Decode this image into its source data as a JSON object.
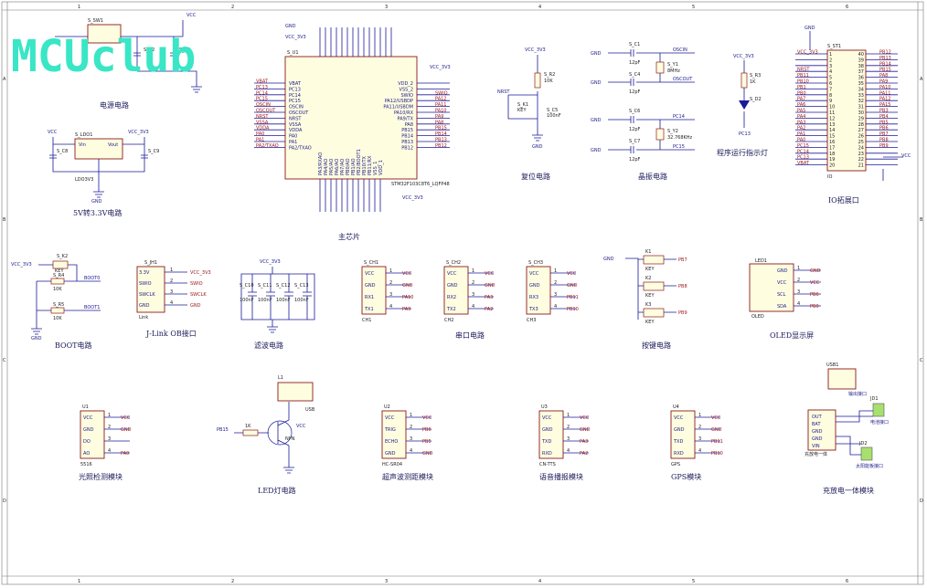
{
  "logo": "MCUclub",
  "sections": {
    "power": "电源电路",
    "ldo": "5V转3.3V电路",
    "main": "主芯片",
    "reset": "复位电路",
    "crystal": "晶振电路",
    "led_run": "程序运行指示灯",
    "io": "IO拓展口",
    "boot": "BOOT电路",
    "jlink": "J-Link OB接口",
    "filter": "滤波电路",
    "serial": "串口电路",
    "key": "按键电路",
    "oled": "OLED显示屏",
    "light": "光照检测模块",
    "ledlamp": "LED灯电路",
    "ultra": "超声波测距模块",
    "voice": "语音播报模块",
    "gps": "GPS模块",
    "charge": "充放电一体模块"
  },
  "mcu": {
    "ref": "S_U1",
    "part": "STM32F103C8T6_LQFP48",
    "left_pins": [
      "VBAT",
      "PC13",
      "PC14",
      "PC15",
      "OSCIN",
      "OSCOUT",
      "NRST",
      "VSSA",
      "VDDA",
      "PA0",
      "PA1",
      "PA2/TXAO"
    ],
    "right_pins": [
      "VDD_2",
      "VSS_2",
      "SWIO",
      "PA12/USBDP",
      "PA11/USBDM",
      "PA10/RX",
      "PA9/TX",
      "PA8",
      "PB15",
      "PB14",
      "PB13",
      "PB12"
    ],
    "right_nets": [
      "",
      "",
      "SWIO",
      "PA12",
      "PA11",
      "PA10",
      "PA9",
      "PA8",
      "PB15",
      "PB14",
      "PB13",
      "PB12"
    ],
    "bottom_pins": [
      "PA3/RXAO",
      "PA4/AO",
      "PA5/AO",
      "PA6/AO",
      "PA7/AO",
      "PB0/AO",
      "PB1/AO",
      "PB2/BOOT1",
      "PB10/TX",
      "PB11/RX",
      "VSS_1",
      "VDD_1"
    ],
    "net_vcc": "VCC_3V3",
    "gnd": "GND"
  },
  "power": {
    "switch": "S_SW1",
    "cap1": "S_C2",
    "cap2": "S_C3",
    "vcc": "VCC"
  },
  "ldo": {
    "ref": "S_LDO1",
    "part": "LDO3V3",
    "vin": "Vin",
    "vout": "Vout",
    "c_in": "S_C8",
    "c_out": "S_C9",
    "vcc_in": "VCC",
    "vcc_out": "VCC_3V3",
    "gnd": "GND"
  },
  "reset": {
    "net": "NRST",
    "res": "S_R2",
    "res_val": "10K",
    "key": "S_K1",
    "key_val": "KEY",
    "cap": "S_C5",
    "cap_val": "100nF",
    "vcc": "VCC_3V3",
    "gnd": "GND"
  },
  "crystal": {
    "c1": "S_C1",
    "c2": "S_C4",
    "c3": "S_C6",
    "c4": "S_C7",
    "cap_val": "12pF",
    "y1": "S_Y1",
    "y1_val": "8MHz",
    "y2": "S_Y2",
    "y2_val": "32.768KHz",
    "nets": [
      "OSCIN",
      "OSCOUT",
      "PC14",
      "PC15"
    ],
    "gnd": "GND"
  },
  "led_run": {
    "vcc": "VCC_3V3",
    "res": "S_R3",
    "res_val": "1K",
    "led": "S_D2",
    "net": "PC13"
  },
  "io": {
    "ref": "S_ST1",
    "part": "IO",
    "left": [
      "VCC_3V3",
      "",
      "",
      "NRST",
      "PB11",
      "PB10",
      "PB1",
      "PB0",
      "PA7",
      "PA6",
      "PA5",
      "PA4",
      "PA3",
      "PA2",
      "PA1",
      "PA0",
      "PC15",
      "PC14",
      "PC13",
      "VBAT"
    ],
    "right": [
      "PB12",
      "PB13",
      "PB14",
      "PB15",
      "PA8",
      "PA9",
      "PA10",
      "PA11",
      "PA12",
      "PA15",
      "PB3",
      "PB4",
      "PB5",
      "PB6",
      "PB7",
      "PB8",
      "PB9",
      "",
      "",
      ""
    ],
    "vcc": "VCC",
    "gnd": "GND"
  },
  "boot": {
    "key": "S_K2",
    "key_val": "KEY",
    "r4": "S_R4",
    "r5": "S_R5",
    "res_val": "10K",
    "net0": "BOOT0",
    "net1": "BOOT1",
    "vcc": "VCC_3V3",
    "gnd": "GND"
  },
  "jlink": {
    "ref": "S_JH1",
    "pins": [
      "3.3V",
      "SWIO",
      "SWCLK",
      "GND"
    ],
    "nets": [
      "VCC_3V3",
      "SWIO",
      "SWCLK",
      "GND"
    ],
    "label": "Link"
  },
  "filter": {
    "caps": [
      "S_C10",
      "S_C11",
      "S_C12",
      "S_C13"
    ],
    "cap_val": "100nF",
    "vcc": "VCC_3V3",
    "gnd": "GND"
  },
  "serial": [
    {
      "ref": "S_CH1",
      "label": "CH1",
      "pins": [
        "VCC",
        "GND",
        "RX1",
        "TX1"
      ],
      "nets": [
        "VCC",
        "GND",
        "PA10",
        "PA9"
      ]
    },
    {
      "ref": "S_CH2",
      "label": "CH2",
      "pins": [
        "VCC",
        "GND",
        "RX2",
        "TX2"
      ],
      "nets": [
        "VCC",
        "GND",
        "PA3",
        "PA2"
      ]
    },
    {
      "ref": "S_CH3",
      "label": "CH3",
      "pins": [
        "VCC",
        "GND",
        "RX3",
        "TX3"
      ],
      "nets": [
        "VCC",
        "GND",
        "PB11",
        "PB10"
      ]
    }
  ],
  "keys": {
    "refs": [
      "K1",
      "K2",
      "K3"
    ],
    "val": "KEY",
    "nets": [
      "PB7",
      "PB8",
      "PB9"
    ],
    "gnd": "GND"
  },
  "oled": {
    "ref": "LED1",
    "label": "OLED",
    "pins": [
      "GND",
      "VCC",
      "SCL",
      "SDA"
    ],
    "nets": [
      "GND",
      "VCC",
      "PB6",
      "PB0"
    ]
  },
  "light": {
    "ref": "U1",
    "part": "5516",
    "pins": [
      "VCC",
      "GND",
      "DO",
      "AO"
    ],
    "nets": [
      "VCC",
      "GND",
      "",
      "PA0"
    ]
  },
  "ledlamp": {
    "ref": "L1",
    "res": "1K",
    "net": "PB15",
    "tr": "NPN",
    "usb": "USB",
    "vcc": "VCC",
    "gnd": "GND"
  },
  "ultra": {
    "ref": "U2",
    "part": "HC-SR04",
    "pins": [
      "VCC",
      "TRIG",
      "ECHO",
      "GND"
    ],
    "nets": [
      "VCC",
      "PB6",
      "PB5",
      "GND"
    ]
  },
  "voice": {
    "ref": "U3",
    "part": "CN-TTS",
    "pins": [
      "VCC",
      "GND",
      "TXD",
      "RXD"
    ],
    "nets": [
      "VCC",
      "GND",
      "PA3",
      "PA2"
    ]
  },
  "gps": {
    "ref": "U4",
    "part": "GPS",
    "pins": [
      "VCC",
      "GND",
      "TXD",
      "RXD"
    ],
    "nets": [
      "VCC",
      "GND",
      "PB11",
      "PB10"
    ]
  },
  "charge": {
    "usb": "USB1",
    "ref": "充放电一体",
    "pins": [
      "OUT",
      "BAT",
      "GND",
      "GND",
      "VIN"
    ],
    "j1": "JD1",
    "j2": "JD2",
    "j_out": "输出接口",
    "j_bat": "电池接口",
    "j_solar": "太阳能板接口"
  },
  "frame": {
    "cols": [
      "1",
      "2",
      "3",
      "4",
      "5",
      "6"
    ],
    "rows": [
      "A",
      "B",
      "C",
      "D"
    ]
  }
}
